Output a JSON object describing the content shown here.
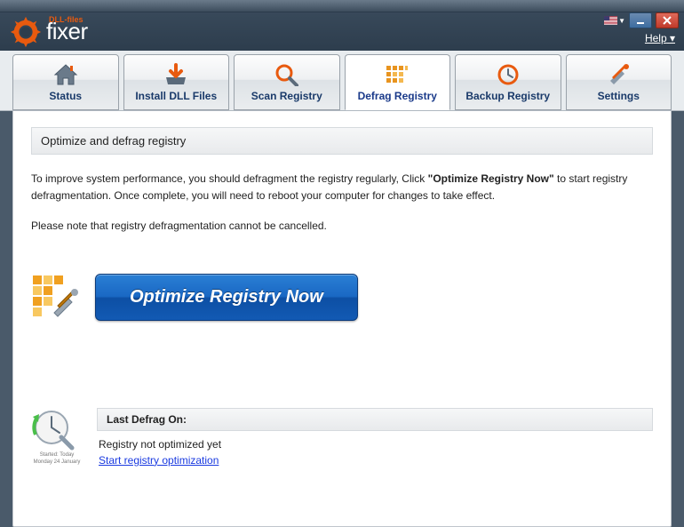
{
  "app": {
    "brand_main": "fixer",
    "brand_sub": "DLL-files",
    "help_label": "Help",
    "help_chevron": "▾"
  },
  "tabs": [
    {
      "id": "status",
      "label": "Status"
    },
    {
      "id": "install",
      "label": "Install DLL Files"
    },
    {
      "id": "scan",
      "label": "Scan Registry"
    },
    {
      "id": "defrag",
      "label": "Defrag Registry"
    },
    {
      "id": "backup",
      "label": "Backup Registry"
    },
    {
      "id": "settings",
      "label": "Settings"
    }
  ],
  "active_tab": "defrag",
  "panel": {
    "title": "Optimize and defrag registry",
    "intro_pre": "To improve system performance, you should defragment the registry regularly, Click ",
    "intro_bold": "\"Optimize Registry Now\"",
    "intro_post": " to start registry defragmentation. Once complete, you will need to reboot your computer for changes to take effect.",
    "note": "Please note that registry defragmentation cannot be cancelled.",
    "button_label": "Optimize Registry Now"
  },
  "status": {
    "heading": "Last Defrag On:",
    "value": "Registry not optimized yet",
    "link": "Start registry optimization",
    "clock_caption1": "Started: Today",
    "clock_caption2": "Monday 24 January"
  },
  "colors": {
    "accent_orange": "#e85a0f",
    "button_blue": "#125ab4",
    "link_blue": "#1a3ae0"
  }
}
